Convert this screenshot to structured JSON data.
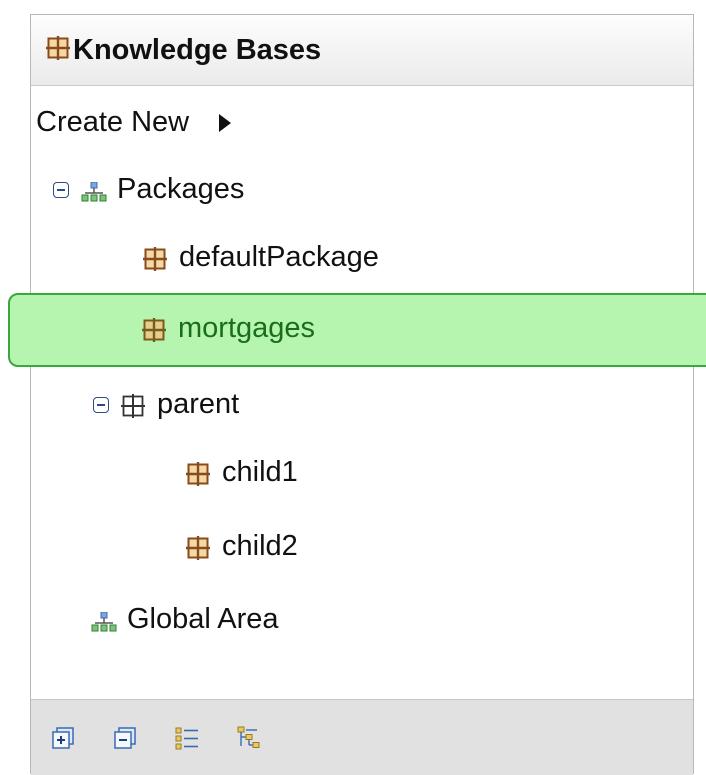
{
  "panel": {
    "title": "Knowledge Bases",
    "create_new_label": "Create New",
    "tree": {
      "packages_label": "Packages",
      "default_package_label": "defaultPackage",
      "mortgages_label": "mortgages",
      "parent_label": "parent",
      "child1_label": "child1",
      "child2_label": "child2",
      "global_area_label": "Global Area"
    },
    "selected_item": "mortgages",
    "footer": {
      "buttons": [
        "expand-all-icon",
        "collapse-all-icon",
        "flat-view-icon",
        "hierarchical-view-icon"
      ]
    }
  },
  "colors": {
    "selection_fill": "#b5f5b0",
    "selection_border": "#3ea63e",
    "package_icon": "#8b4a1a"
  }
}
